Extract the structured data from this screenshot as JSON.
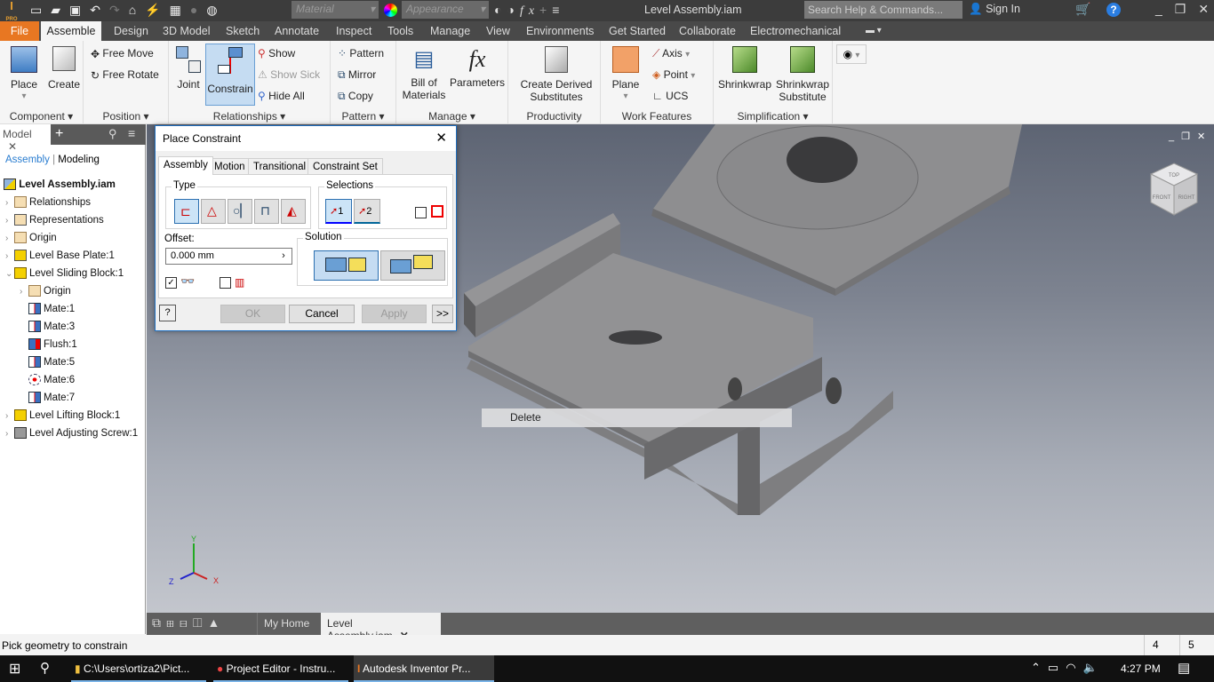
{
  "title_bar": {
    "app_badge": "PRO",
    "material_placeholder": "Material",
    "appearance_placeholder": "Appearance",
    "document_title": "Level Assembly.iam",
    "search_placeholder": "Search Help & Commands...",
    "sign_in": "Sign In"
  },
  "ribbon_tabs": [
    "File",
    "Assemble",
    "Design",
    "3D Model",
    "Sketch",
    "Annotate",
    "Inspect",
    "Tools",
    "Manage",
    "View",
    "Environments",
    "Get Started",
    "Collaborate",
    "Electromechanical"
  ],
  "active_tab": "Assemble",
  "ribbon": {
    "component": {
      "title": "Component",
      "place": "Place",
      "create": "Create"
    },
    "position": {
      "title": "Position",
      "free_move": "Free Move",
      "free_rotate": "Free Rotate"
    },
    "relationships": {
      "title": "Relationships",
      "joint": "Joint",
      "constrain": "Constrain",
      "show": "Show",
      "show_sick": "Show Sick",
      "hide_all": "Hide All"
    },
    "pattern": {
      "title": "Pattern",
      "pattern": "Pattern",
      "mirror": "Mirror",
      "copy": "Copy"
    },
    "manage": {
      "title": "Manage",
      "bom_line1": "Bill of",
      "bom_line2": "Materials",
      "parameters": "Parameters"
    },
    "productivity": {
      "title": "Productivity",
      "cds_line1": "Create Derived",
      "cds_line2": "Substitutes"
    },
    "work_features": {
      "title": "Work Features",
      "plane": "Plane",
      "axis": "Axis",
      "point": "Point",
      "ucs": "UCS"
    },
    "simplification": {
      "title": "Simplification",
      "shrinkwrap": "Shrinkwrap",
      "sws_line1": "Shrinkwrap",
      "sws_line2": "Substitute"
    }
  },
  "browser": {
    "tab": "Model",
    "mode_assembly": "Assembly",
    "mode_modeling": "Modeling",
    "root": "Level Assembly.iam",
    "items": [
      {
        "label": "Relationships",
        "level": 1,
        "icon": "folder"
      },
      {
        "label": "Representations",
        "level": 1,
        "icon": "representations"
      },
      {
        "label": "Origin",
        "level": 1,
        "icon": "folder"
      },
      {
        "label": "Level Base Plate:1",
        "level": 1,
        "icon": "grounded-part"
      },
      {
        "label": "Level Sliding Block:1",
        "level": 1,
        "icon": "part",
        "expanded": true
      },
      {
        "label": "Origin",
        "level": 2,
        "icon": "folder"
      },
      {
        "label": "Mate:1",
        "level": 2,
        "icon": "mate"
      },
      {
        "label": "Mate:3",
        "level": 2,
        "icon": "mate"
      },
      {
        "label": "Flush:1",
        "level": 2,
        "icon": "flush"
      },
      {
        "label": "Mate:5",
        "level": 2,
        "icon": "mate"
      },
      {
        "label": "Mate:6",
        "level": 2,
        "icon": "mate-axis"
      },
      {
        "label": "Mate:7",
        "level": 2,
        "icon": "mate"
      },
      {
        "label": "Level Lifting Block:1",
        "level": 1,
        "icon": "part"
      },
      {
        "label": "Level Adjusting Screw:1",
        "level": 1,
        "icon": "part-gray"
      }
    ]
  },
  "dialog": {
    "title": "Place Constraint",
    "tabs": [
      "Assembly",
      "Motion",
      "Transitional",
      "Constraint Set"
    ],
    "active_tab": "Assembly",
    "type_label": "Type",
    "types": [
      "mate",
      "angle",
      "tangent",
      "insert",
      "symmetry"
    ],
    "selected_type": "mate",
    "selections_label": "Selections",
    "selection1": "1",
    "selection2": "2",
    "offset_label": "Offset:",
    "offset_value": "0.000 mm",
    "solution_label": "Solution",
    "show_preview_checked": true,
    "predict_offset_checked": false,
    "first_part_checked": false,
    "ok": "OK",
    "cancel": "Cancel",
    "apply": "Apply",
    "more": ">>"
  },
  "context_menu": {
    "item": "Delete"
  },
  "viewcube": {
    "top": "TOP",
    "front": "FRONT",
    "right": "RIGHT"
  },
  "triad": {
    "x": "X",
    "y": "Y",
    "z": "Z"
  },
  "doc_tabs": {
    "home": "My Home",
    "active": "Level Assembly.iam"
  },
  "status": {
    "prompt": "Pick geometry to constrain",
    "count1": "4",
    "count2": "5"
  },
  "taskbar": {
    "items": [
      "C:\\Users\\ortiza2\\Pict...",
      "Project Editor - Instru...",
      "Autodesk Inventor Pr..."
    ],
    "time": "4:27 PM"
  },
  "colors": {
    "file_tab": "#e87722",
    "accent": "#2b6fb0",
    "selected_button": "#c5dcf2"
  }
}
